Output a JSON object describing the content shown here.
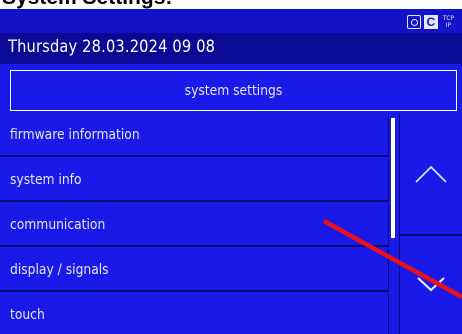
{
  "page_heading": "System Settings:",
  "status_icons": {
    "screenshot": "camera-icon",
    "connection": "c-icon",
    "network_top": "TCP",
    "network_bottom": "IP"
  },
  "datetime": "Thursday  28.03.2024  09 08",
  "title": "system settings",
  "menu": {
    "items": [
      {
        "label": "firmware information"
      },
      {
        "label": "system info"
      },
      {
        "label": "communication"
      },
      {
        "label": "display / signals"
      },
      {
        "label": "touch"
      }
    ]
  },
  "scroll": {
    "up_icon": "chevron-up-icon",
    "down_icon": "chevron-down-icon"
  },
  "colors": {
    "panel": "#1a1ae8",
    "date_bar": "#0a0a96",
    "separator": "#0b0b78",
    "text": "#e6e6ff",
    "annotation_line": "#e8101a"
  }
}
